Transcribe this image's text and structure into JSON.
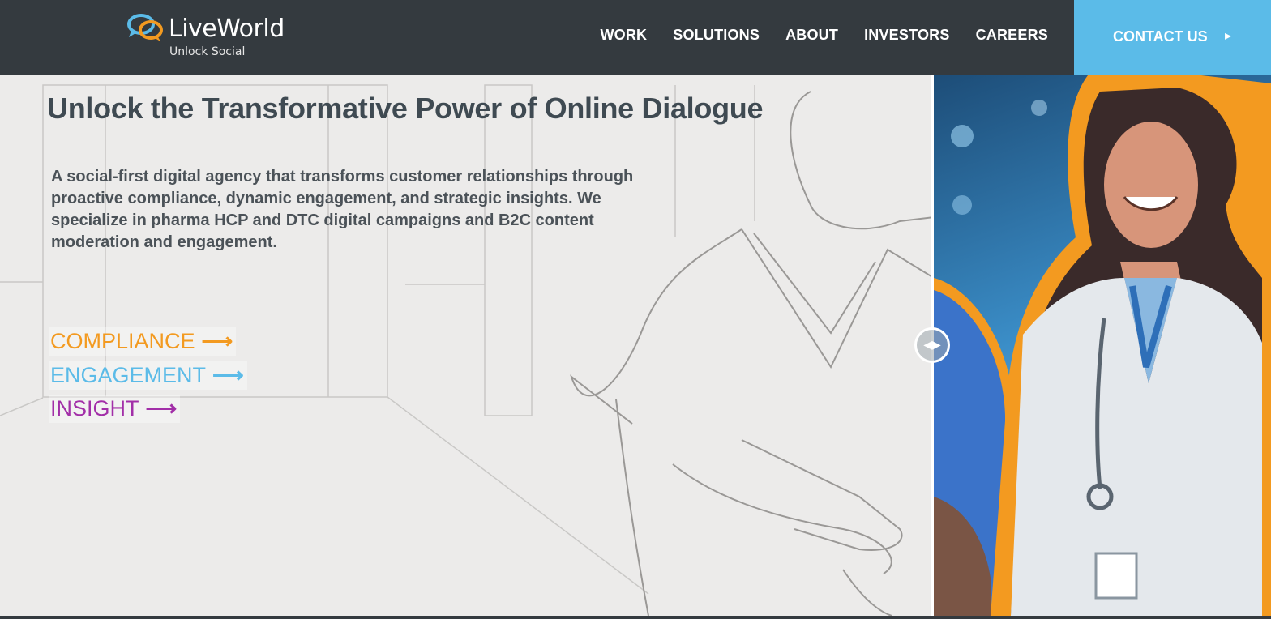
{
  "brand": {
    "name": "LiveWorld",
    "tagline": "Unlock Social"
  },
  "nav": {
    "items": [
      "WORK",
      "SOLUTIONS",
      "ABOUT",
      "INVESTORS",
      "CAREERS"
    ],
    "contact_label": "CONTACT US"
  },
  "hero": {
    "headline": "Unlock the Transformative Power of Online Dialogue",
    "description": "A social-first digital agency that transforms customer relationships through proactive compliance, dynamic engagement, and strategic insights. We specialize in pharma HCP and DTC digital campaigns and B2C content moderation and engagement.",
    "pillars": [
      {
        "label": "COMPLIANCE",
        "color": "#f39a20"
      },
      {
        "label": "ENGAGEMENT",
        "color": "#5bbbe8"
      },
      {
        "label": "INSIGHT",
        "color": "#a22fa8"
      }
    ]
  },
  "colors": {
    "header_bg": "#343a3f",
    "accent_blue": "#5bbbe8",
    "headline": "#3f4a52"
  },
  "icons": {
    "logo": "speech-bubbles-icon",
    "contact_arrow": "chevron-right-icon",
    "pillar_arrow": "arrow-right-icon",
    "slider": "compare-slider-icon"
  }
}
